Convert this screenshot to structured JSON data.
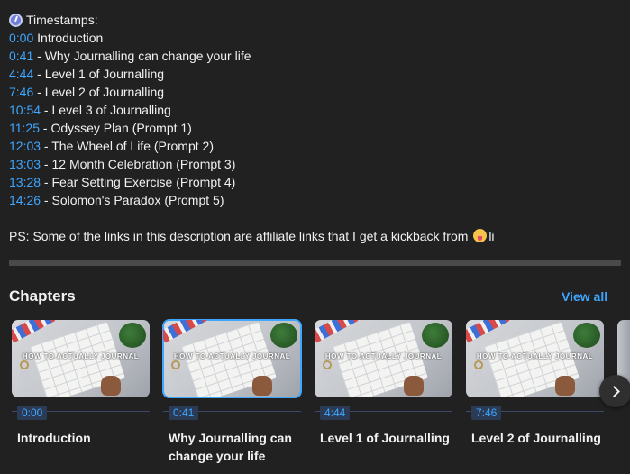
{
  "description": {
    "timestamps_heading": "Timestamps:",
    "timestamps": [
      {
        "time": "0:00",
        "sep": " ",
        "label": "Introduction"
      },
      {
        "time": "0:41",
        "sep": " - ",
        "label": "Why Journalling can change your life"
      },
      {
        "time": "4:44",
        "sep": " - ",
        "label": "Level 1 of Journalling"
      },
      {
        "time": "7:46",
        "sep": " - ",
        "label": "Level 2 of Journalling"
      },
      {
        "time": "10:54",
        "sep": " - ",
        "label": "Level 3 of Journalling"
      },
      {
        "time": "11:25",
        "sep": " - ",
        "label": "Odyssey Plan (Prompt 1)"
      },
      {
        "time": "12:03",
        "sep": " - ",
        "label": "The Wheel of Life (Prompt 2)"
      },
      {
        "time": "13:03",
        "sep": " - ",
        "label": "12 Month Celebration (Prompt 3)"
      },
      {
        "time": "13:28",
        "sep": " - ",
        "label": "Fear Setting Exercise (Prompt 4)"
      },
      {
        "time": "14:26",
        "sep": " - ",
        "label": "Solomon's Paradox (Prompt 5)"
      }
    ],
    "ps_text": "PS: Some of the links in this description are affiliate links that I get a kickback from",
    "ps_tail": "li"
  },
  "chapters": {
    "title": "Chapters",
    "view_all": "View all",
    "thumbnail_text": "HOW TO ACTUALLY JOURNAL",
    "items": [
      {
        "time": "0:00",
        "title": "Introduction"
      },
      {
        "time": "0:41",
        "title": "Why Journalling can change your life"
      },
      {
        "time": "4:44",
        "title": "Level 1 of Journalling"
      },
      {
        "time": "7:46",
        "title": "Level 2 of Journalling"
      }
    ]
  },
  "colors": {
    "link": "#3ea6ff",
    "background": "#212121",
    "text": "#f1f1f1"
  },
  "icons": {
    "heading": "stopwatch-icon",
    "ps": "face-with-tongue-emoji",
    "next": "chevron-right-icon"
  }
}
